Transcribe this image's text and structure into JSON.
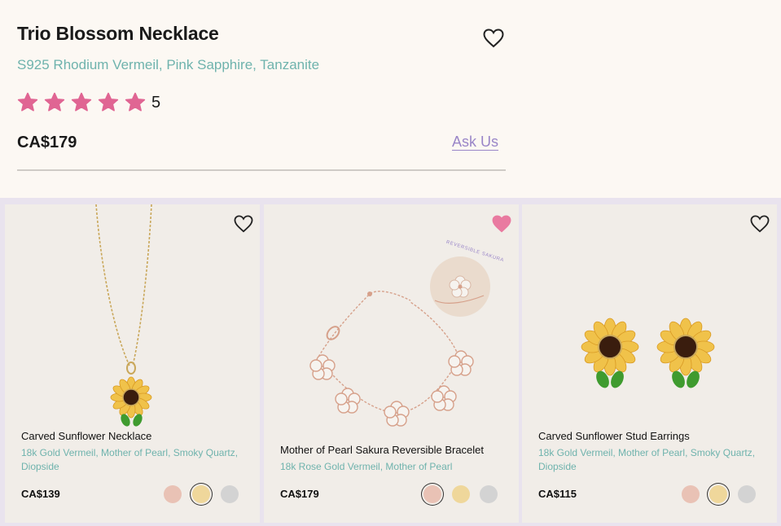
{
  "product": {
    "title": "Trio Blossom Necklace",
    "materials": "S925 Rhodium Vermeil, Pink Sapphire, Tanzanite",
    "rating": "5",
    "stars": 5,
    "price": "CA$179",
    "ask_us": "Ask Us",
    "wishlist_icon": "heart-outline-icon"
  },
  "colors": {
    "star": "#e06593",
    "accent_teal": "#6fb3ad",
    "ask_us": "#9a86c8",
    "heart_active": "#e97aa0",
    "rose": "#e9c2b5",
    "gold": "#efd79b",
    "silver": "#d3d3d3"
  },
  "cards": [
    {
      "name": "Carved Sunflower Necklace",
      "materials_line1": "18k Gold Vermeil, Mother of Pearl, Smoky Quartz,",
      "materials_line2": "Diopside",
      "price": "CA$139",
      "wishlisted": false,
      "swatches": [
        "rose",
        "gold",
        "silver"
      ],
      "selected": "gold"
    },
    {
      "name": "Mother of Pearl Sakura Reversible Bracelet",
      "materials_line1": "18k Rose Gold Vermeil, Mother of Pearl",
      "materials_line2": "",
      "price": "CA$179",
      "badge": "REVERSIBLE SAKURA",
      "wishlisted": true,
      "swatches": [
        "rose",
        "gold",
        "silver"
      ],
      "selected": "rose"
    },
    {
      "name": "Carved Sunflower Stud Earrings",
      "materials_line1": "18k Gold Vermeil, Mother of Pearl, Smoky Quartz,",
      "materials_line2": "Diopside",
      "price": "CA$115",
      "wishlisted": false,
      "swatches": [
        "rose",
        "gold",
        "silver"
      ],
      "selected": "gold"
    }
  ]
}
